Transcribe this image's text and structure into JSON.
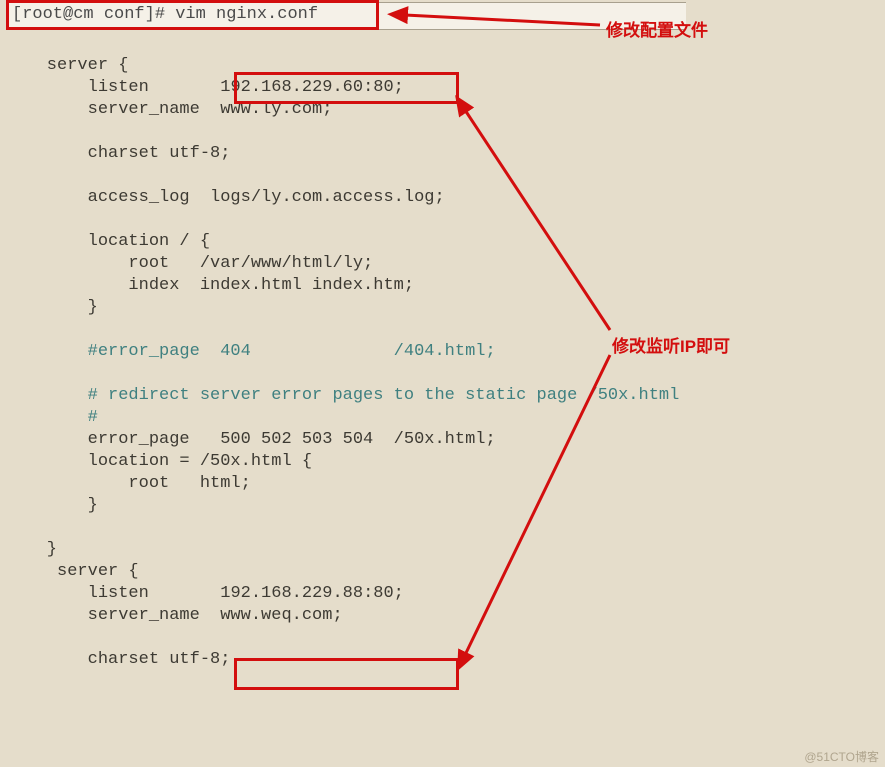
{
  "terminal": {
    "prompt": "[root@cm conf]# vim nginx.conf"
  },
  "annotations": {
    "top": "修改配置文件",
    "middle": "修改监听IP即可"
  },
  "code": {
    "l0": "    server {",
    "l1_a": "        listen       ",
    "l1_b": "192.168.229.60:80;",
    "l2": "        server_name  www.ly.com;",
    "l3": "",
    "l4": "        charset utf-8;",
    "l5": "",
    "l6": "        access_log  logs/ly.com.access.log;",
    "l7": "",
    "l8": "        location / {",
    "l9": "            root   /var/www/html/ly;",
    "l10": "            index  index.html index.htm;",
    "l11": "        }",
    "l12": "",
    "l13": "        #error_page  404              /404.html;",
    "l14": "",
    "l15": "        # redirect server error pages to the static page /50x.html",
    "l16": "        #",
    "l17": "        error_page   500 502 503 504  /50x.html;",
    "l18": "        location = /50x.html {",
    "l19": "            root   html;",
    "l20": "        }",
    "l21": "",
    "l22": "    }",
    "l23": "     server {",
    "l24_a": "        listen       ",
    "l24_b": "192.168.229.88:80;",
    "l25": "        server_name  www.weq.com;",
    "l26": "",
    "l27": "        charset utf-8;"
  },
  "watermark": "@51CTO博客"
}
